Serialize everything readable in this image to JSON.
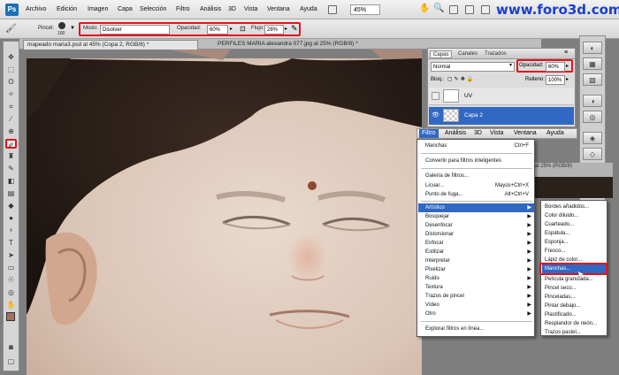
{
  "watermark": "www.foro3d.com",
  "menubar": {
    "logo": "Ps",
    "items": [
      "Archivo",
      "Edición",
      "Imagen",
      "Capa",
      "Selección",
      "Filtro",
      "Análisis",
      "3D",
      "Vista",
      "Ventana",
      "Ayuda"
    ],
    "zoom": "45%"
  },
  "options": {
    "brush_label": "Pincel:",
    "brush_size": "100",
    "mode_label": "Modo:",
    "mode_value": "Disolver",
    "opacity_label": "Opacidad:",
    "opacity_value": "60%",
    "flow_label": "Flujo:",
    "flow_value": "28%"
  },
  "tabs": [
    "mapeado maria3.psd al 45% (Copa 2, RGB/8) *",
    "PERFILES MARIA alexandra 077.jpg al 25% (RGB/8) *"
  ],
  "layers": {
    "tabs": [
      "Capas",
      "Canales",
      "Trazados"
    ],
    "blend": "Normal",
    "opacity_label": "Opacidad:",
    "opacity_value": "60%",
    "lock_label": "Bloq.:",
    "fill_label": "Relleno:",
    "fill_value": "100%",
    "rows": [
      "UV",
      "Capa 2"
    ]
  },
  "menu2": {
    "items": [
      "Filtro",
      "Análisis",
      "3D",
      "Vista",
      "Ventana",
      "Ayuda"
    ]
  },
  "bg_tab": "al 25% (RGB/8)",
  "filter_menu": {
    "last": "Manchas",
    "last_shortcut": "Ctrl+F",
    "convert": "Convertir para filtros inteligentes",
    "gallery": "Galería de filtros...",
    "liquify": "Licuar...",
    "liquify_shortcut": "Mayús+Ctrl+X",
    "vanishing": "Punto de fuga...",
    "vanishing_shortcut": "Alt+Ctrl+V",
    "groups": [
      "Artístico",
      "Bosquejar",
      "Desenfocar",
      "Distorsionar",
      "Enfocar",
      "Estilizar",
      "Interpretar",
      "Pixelizar",
      "Ruido",
      "Textura",
      "Trazos de pincel",
      "Vídeo",
      "Otro"
    ],
    "browse": "Explorar filtros en línea..."
  },
  "submenu": {
    "items": [
      "Bordes añadidos...",
      "Color diluido...",
      "Cuarteado...",
      "Espátula...",
      "Esponja...",
      "Fresco...",
      "Lápiz de color...",
      "Manchas...",
      "Película granulada...",
      "Pincel seco...",
      "Pinceladas...",
      "Pintar debajo...",
      "Plastificado...",
      "Resplandor de neón...",
      "Trazos pastel..."
    ]
  },
  "colors": {
    "accent": "#e0141e",
    "highlight": "#3168c4",
    "foreground": "#a86e63",
    "background": "#ffffff"
  }
}
